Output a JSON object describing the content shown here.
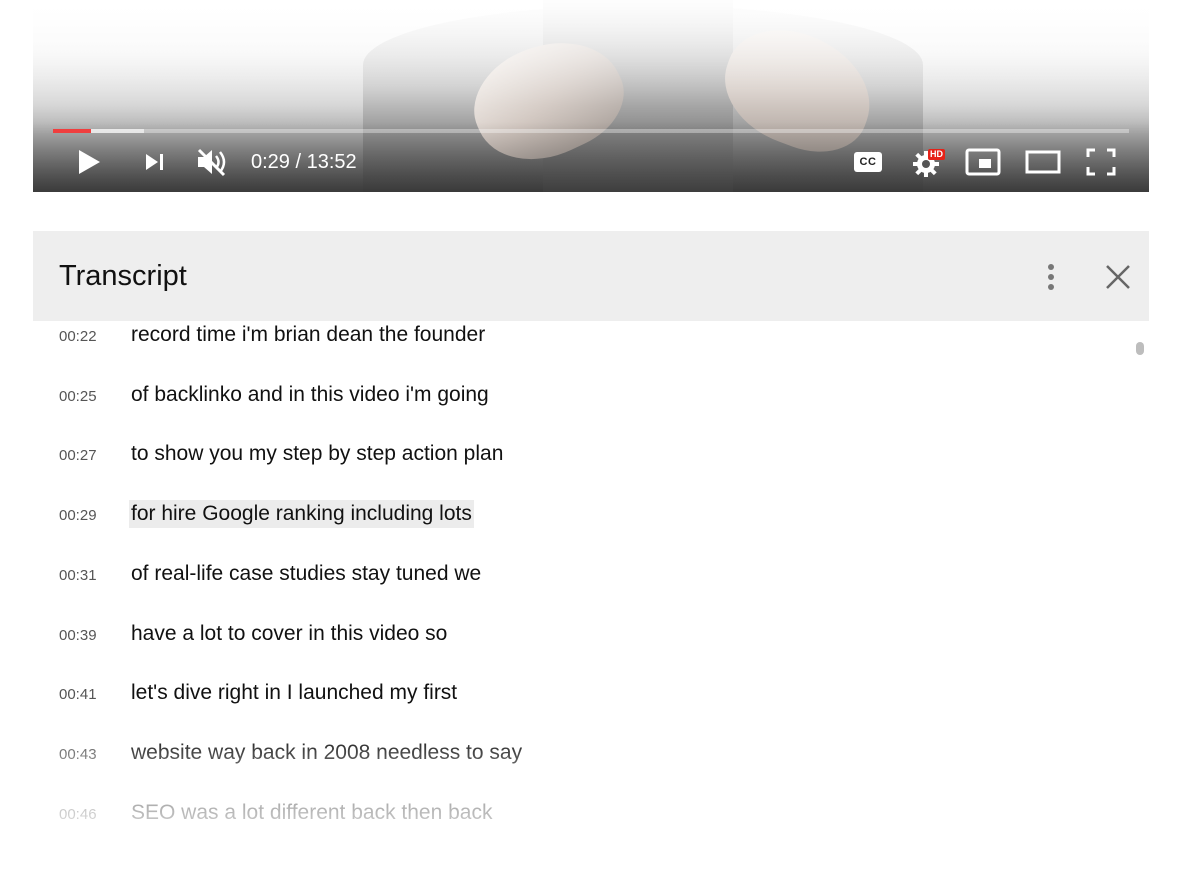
{
  "player": {
    "current_time": "0:29",
    "duration": "13:52",
    "time_display": "0:29 / 13:52",
    "progress_played_fraction": 0.035,
    "progress_buffered_fraction": 0.085,
    "cc_label": "CC",
    "hd_badge": "HD",
    "icons": [
      "play-icon",
      "next-icon",
      "mute-icon",
      "captions-icon",
      "settings-icon",
      "miniplayer-icon",
      "theater-icon",
      "fullscreen-icon"
    ],
    "colors": {
      "progress_played": "#f03e3e"
    }
  },
  "transcript": {
    "title": "Transcript",
    "segments": [
      {
        "time": "00:22",
        "text": "record time i'm brian dean the founder"
      },
      {
        "time": "00:25",
        "text": "of backlinko and in this video i'm going"
      },
      {
        "time": "00:27",
        "text": "to show you my step by step action plan"
      },
      {
        "time": "00:29",
        "text": "for hire Google ranking including lots",
        "active": true
      },
      {
        "time": "00:31",
        "text": "of real-life case studies stay tuned we"
      },
      {
        "time": "00:39",
        "text": "have a lot to cover in this video so"
      },
      {
        "time": "00:41",
        "text": "let's dive right in I launched my first"
      },
      {
        "time": "00:43",
        "text": "website way back in 2008 needless to say"
      },
      {
        "time": "00:46",
        "text": "SEO was a lot different back then back"
      }
    ]
  }
}
